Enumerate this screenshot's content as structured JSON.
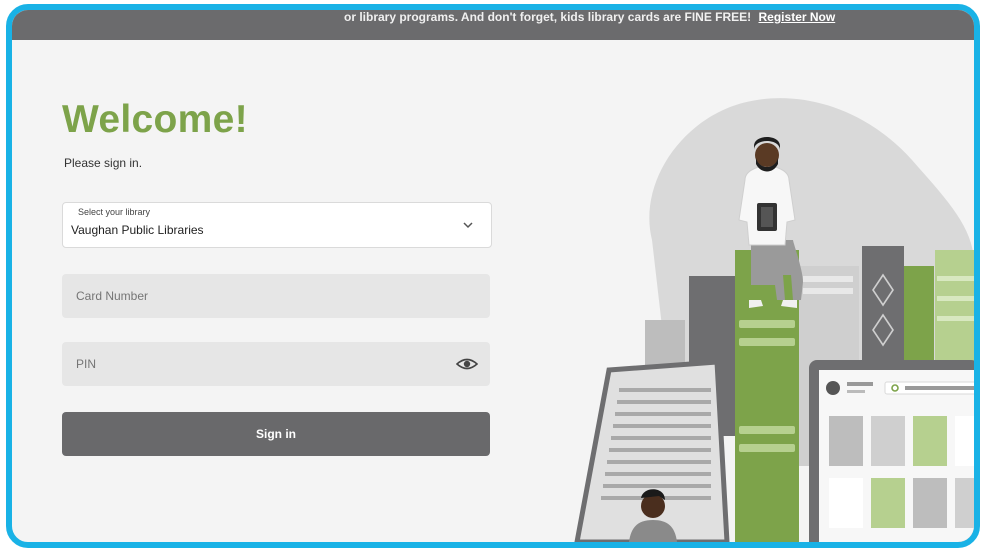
{
  "banner": {
    "text": "or library programs. And don't forget, kids library cards are FINE FREE!",
    "link": "Register Now"
  },
  "welcome": {
    "title": "Welcome!",
    "subtitle": "Please sign in."
  },
  "library_select": {
    "label": "Select your library",
    "value": "Vaughan Public Libraries"
  },
  "card_number": {
    "placeholder": "Card Number"
  },
  "pin": {
    "placeholder": "PIN"
  },
  "signin_button": {
    "label": "Sign in"
  },
  "colors": {
    "accent": "#7da34a",
    "banner": "#6b6b6d",
    "frame": "#19b2e6",
    "button": "#69696b"
  },
  "icons": [
    "chevron-down-icon",
    "eye-icon"
  ]
}
